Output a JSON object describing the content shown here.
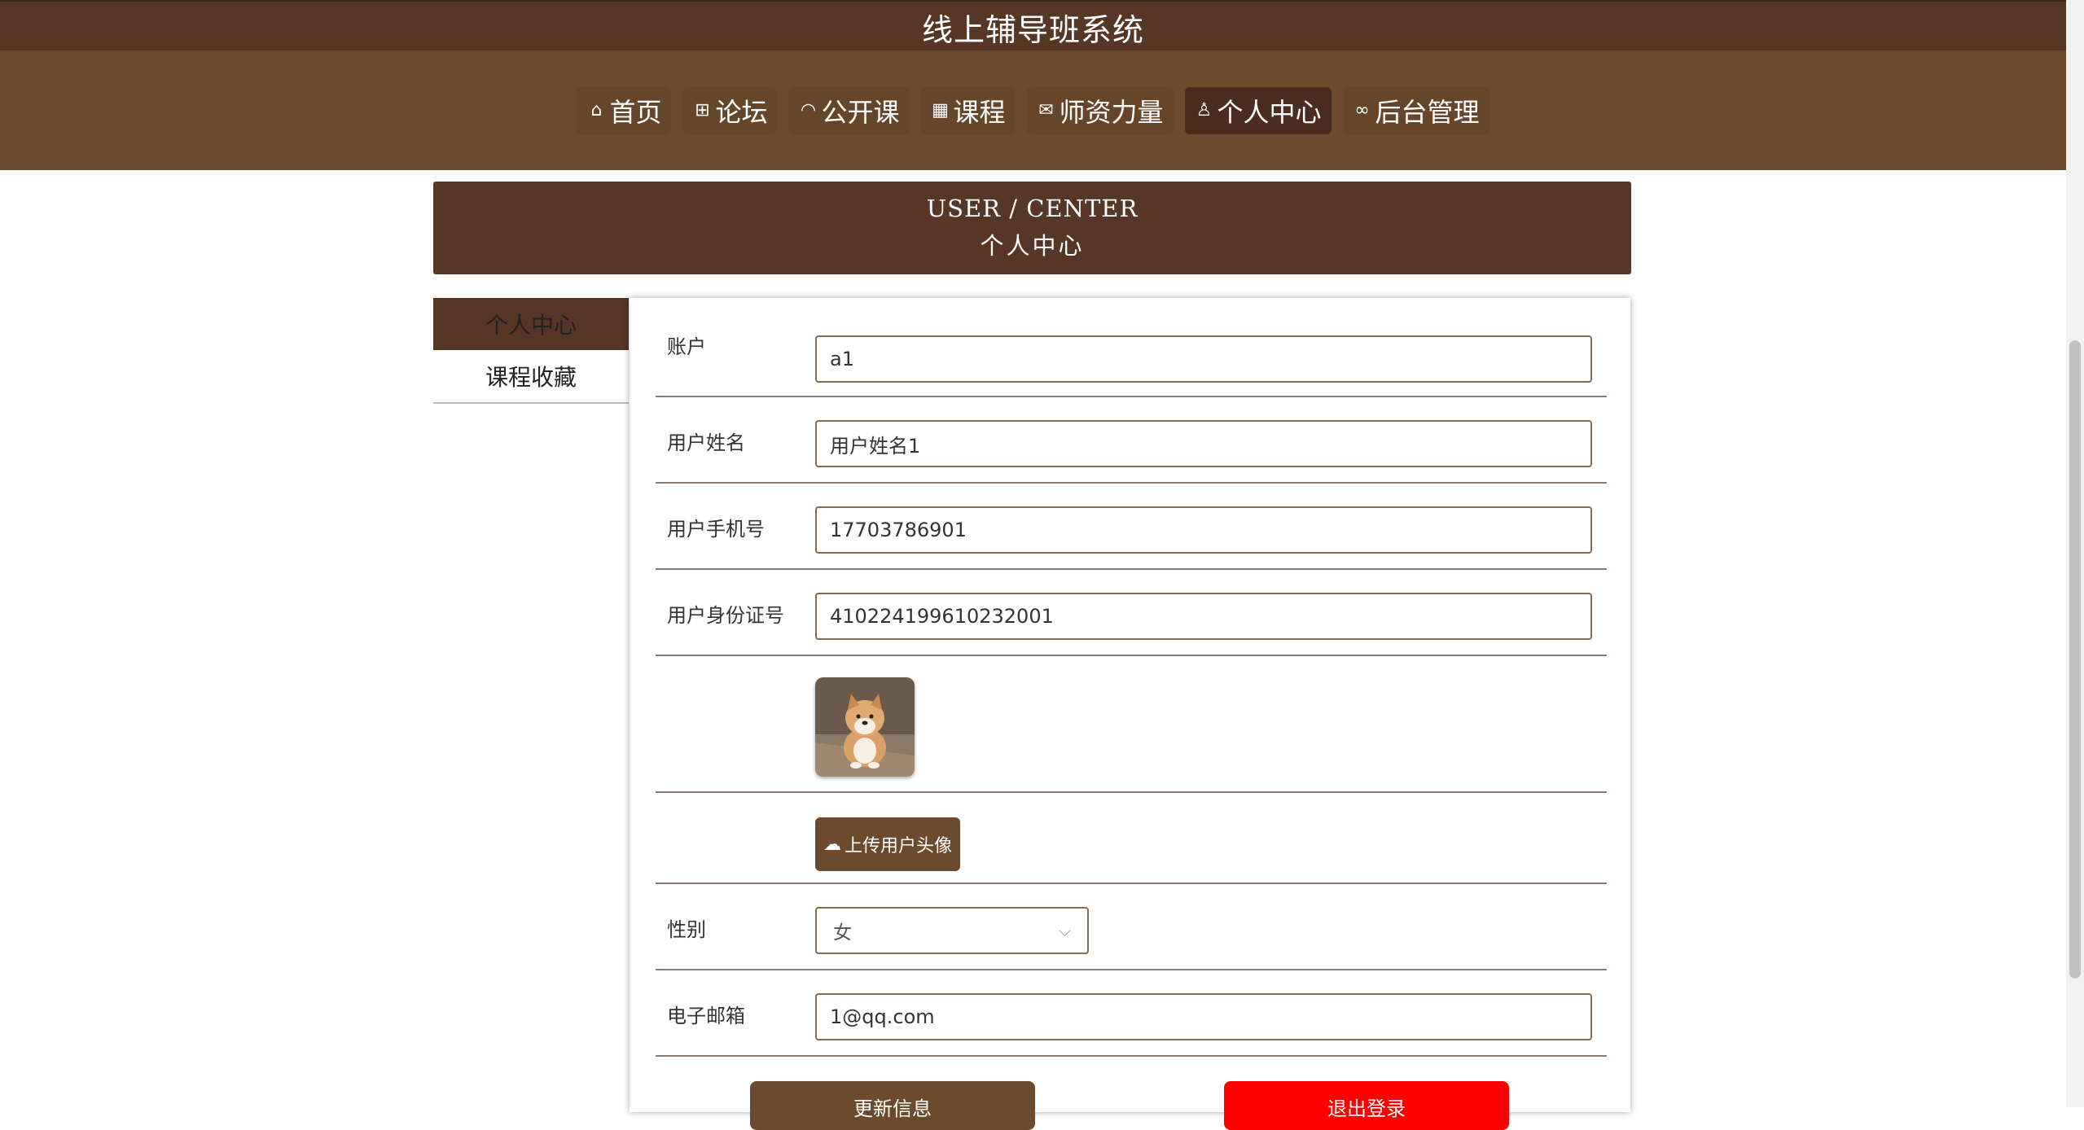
{
  "header": {
    "title": "线上辅导班系统"
  },
  "nav": {
    "items": [
      {
        "icon": "home-icon",
        "glyph": "⌂",
        "label": "首页"
      },
      {
        "icon": "gift-icon",
        "glyph": "⊞",
        "label": "论坛"
      },
      {
        "icon": "gauge-icon",
        "glyph": "◠",
        "label": "公开课"
      },
      {
        "icon": "grid-icon",
        "glyph": "▦",
        "label": "课程"
      },
      {
        "icon": "mail-icon",
        "glyph": "✉",
        "label": "师资力量"
      },
      {
        "icon": "user-icon",
        "glyph": "♙",
        "label": "个人中心"
      },
      {
        "icon": "link-icon",
        "glyph": "∞",
        "label": "后台管理"
      }
    ],
    "active": "个人中心"
  },
  "banner": {
    "en": "USER / CENTER",
    "zh": "个人中心"
  },
  "sidebar": {
    "items": [
      {
        "label": "个人中心"
      },
      {
        "label": "课程收藏"
      }
    ]
  },
  "form": {
    "account": {
      "label": "账户",
      "value": "a1"
    },
    "name": {
      "label": "用户姓名",
      "value": "用户姓名1"
    },
    "phone": {
      "label": "用户手机号",
      "value": "17703786901"
    },
    "idcard": {
      "label": "用户身份证号",
      "value": "410224199610232001"
    },
    "upload_label": "上传用户头像",
    "gender": {
      "label": "性别",
      "value": "女"
    },
    "email": {
      "label": "电子邮箱",
      "value": "1@qq.com"
    },
    "update_label": "更新信息",
    "logout_label": "退出登录"
  },
  "colors": {
    "header_dark": "#563625",
    "nav_brown": "#6c4a2d",
    "logout_red": "#ff0000"
  }
}
